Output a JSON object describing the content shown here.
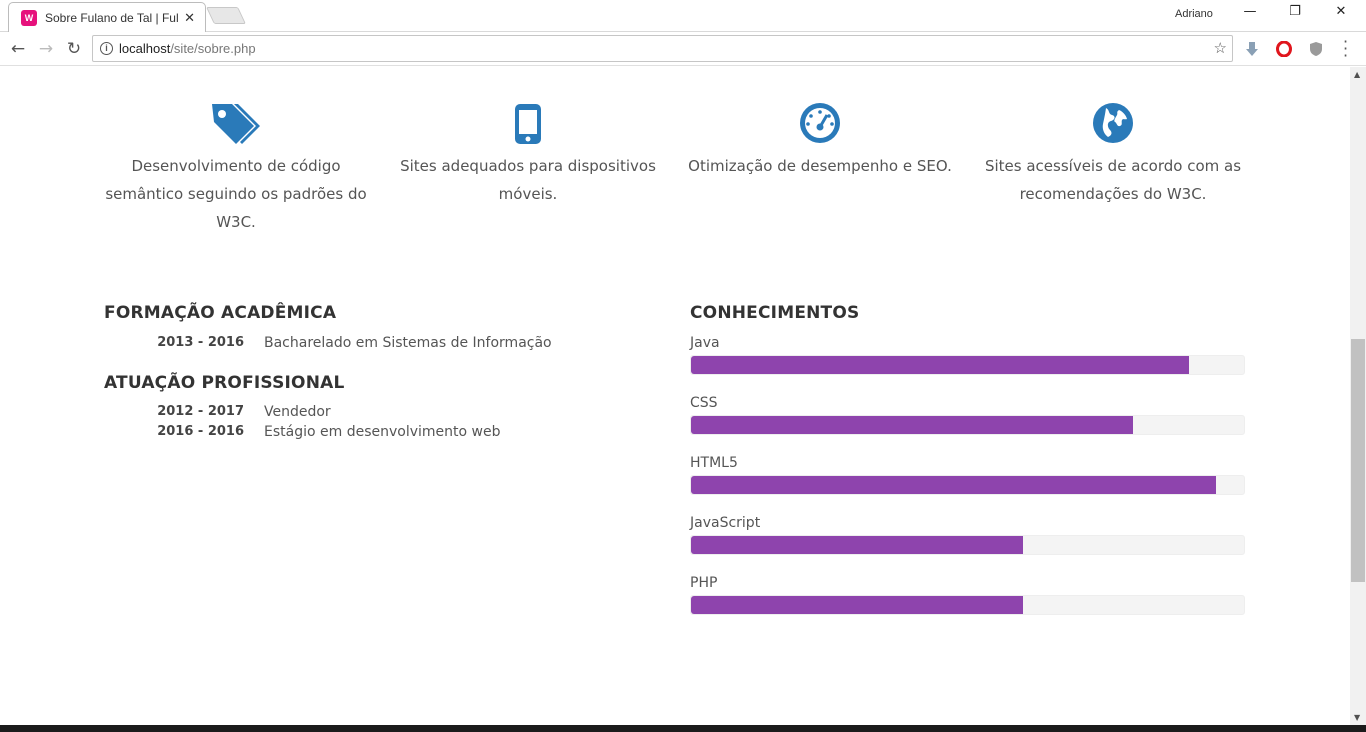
{
  "browser": {
    "tab_title": "Sobre Fulano de Tal | Fula",
    "tab_favicon": "W",
    "profile_name": "Adriano",
    "url_host": "localhost",
    "url_path": "/site/sobre.php",
    "window_controls": [
      "—",
      "❐",
      "✕"
    ]
  },
  "features": [
    {
      "icon": "tags-icon",
      "text": "Desenvolvimento de código semântico seguindo os padrões do W3C."
    },
    {
      "icon": "mobile-icon",
      "text": "Sites adequados para dispositivos móveis."
    },
    {
      "icon": "dashboard-icon",
      "text": "Otimização de desempenho e SEO."
    },
    {
      "icon": "globe-icon",
      "text": "Sites acessíveis de acordo com as recomendações do W3C."
    }
  ],
  "education": {
    "title": "FORMAÇÃO ACADÊMICA",
    "items": [
      {
        "years": "2013 - 2016",
        "desc": "Bacharelado em Sistemas de Informação"
      }
    ]
  },
  "experience": {
    "title": "ATUAÇÃO PROFISSIONAL",
    "items": [
      {
        "years": "2012 - 2017",
        "desc": "Vendedor"
      },
      {
        "years": "2016 - 2016",
        "desc": "Estágio em desenvolvimento web"
      }
    ]
  },
  "skills": {
    "title": "CONHECIMENTOS",
    "bar_color": "#8e44ad",
    "items": [
      {
        "name": "Java",
        "level": 0.9
      },
      {
        "name": "CSS",
        "level": 0.8
      },
      {
        "name": "HTML5",
        "level": 0.95
      },
      {
        "name": "JavaScript",
        "level": 0.6
      },
      {
        "name": "PHP",
        "level": 0.6
      }
    ]
  }
}
